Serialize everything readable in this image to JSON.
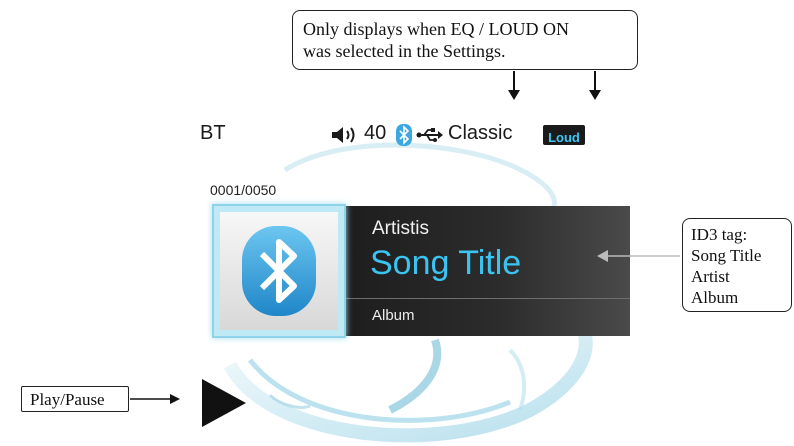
{
  "callouts": {
    "eq_loud": [
      "Only displays when EQ / LOUD ON",
      "was selected in the Settings."
    ],
    "id3": [
      "ID3 tag:",
      "Song Title",
      "Artist",
      "Album"
    ],
    "play_pause": "Play/Pause"
  },
  "status_bar": {
    "source": "BT",
    "volume_icon": "speaker-volume-icon",
    "volume": "40",
    "bluetooth_icon": "bluetooth-icon",
    "usb_icon": "usb-icon",
    "eq_mode": "Classic",
    "loud_badge": "Loud"
  },
  "track": {
    "counter": "0001/0050",
    "artist": "Artistis",
    "title": "Song Title",
    "album": "Album"
  },
  "icons": {
    "cover_art": "bluetooth-icon",
    "playback": "play-icon"
  },
  "colors": {
    "accent": "#3bc3f2",
    "panel": "#222222",
    "loud_badge_bg": "#1a1a1a"
  }
}
